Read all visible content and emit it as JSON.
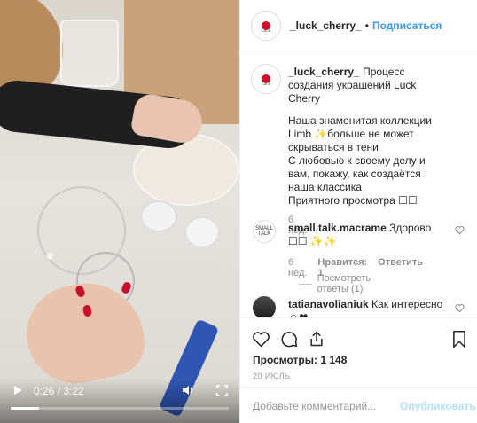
{
  "video": {
    "time": "0:26 / 3:22",
    "progress": 0.13,
    "play_icon": "play-icon",
    "volume_icon": "volume-icon",
    "fullscreen_icon": "fullscreen-icon"
  },
  "header": {
    "username": "_luck_cherry_",
    "separator": "•",
    "follow": "Подписаться",
    "avatar_text": "Luck"
  },
  "caption": {
    "username": "_luck_cherry_",
    "text": "Процесс создания украшений Luck Cherry",
    "p1": "Наша знаменитая коллекции Limb ✨больше не может скрываться в тени",
    "p2": "С любовью к своему делу и вам, покажу, как создаётся наша классика",
    "p3": "Приятного просмотра ☐☐",
    "age": "6 нед."
  },
  "comments": [
    {
      "username": "small.talk.macrame",
      "text": "Здорово ☐☐ ✨✨",
      "avatar_text": "SMALL TALK",
      "age": "6 нед.",
      "likes": "Нравится: 1",
      "reply": "Ответить",
      "view_replies": "Посмотреть ответы (1)"
    },
    {
      "username": "tatianavolianiuk",
      "text": "Как интересно ☺❤"
    }
  ],
  "actions": {
    "views": "Просмотры: 1 148",
    "date": "20 ИЮЛЬ"
  },
  "add_comment": {
    "placeholder": "Добавьте комментарий...",
    "post": "Опубликовать"
  }
}
